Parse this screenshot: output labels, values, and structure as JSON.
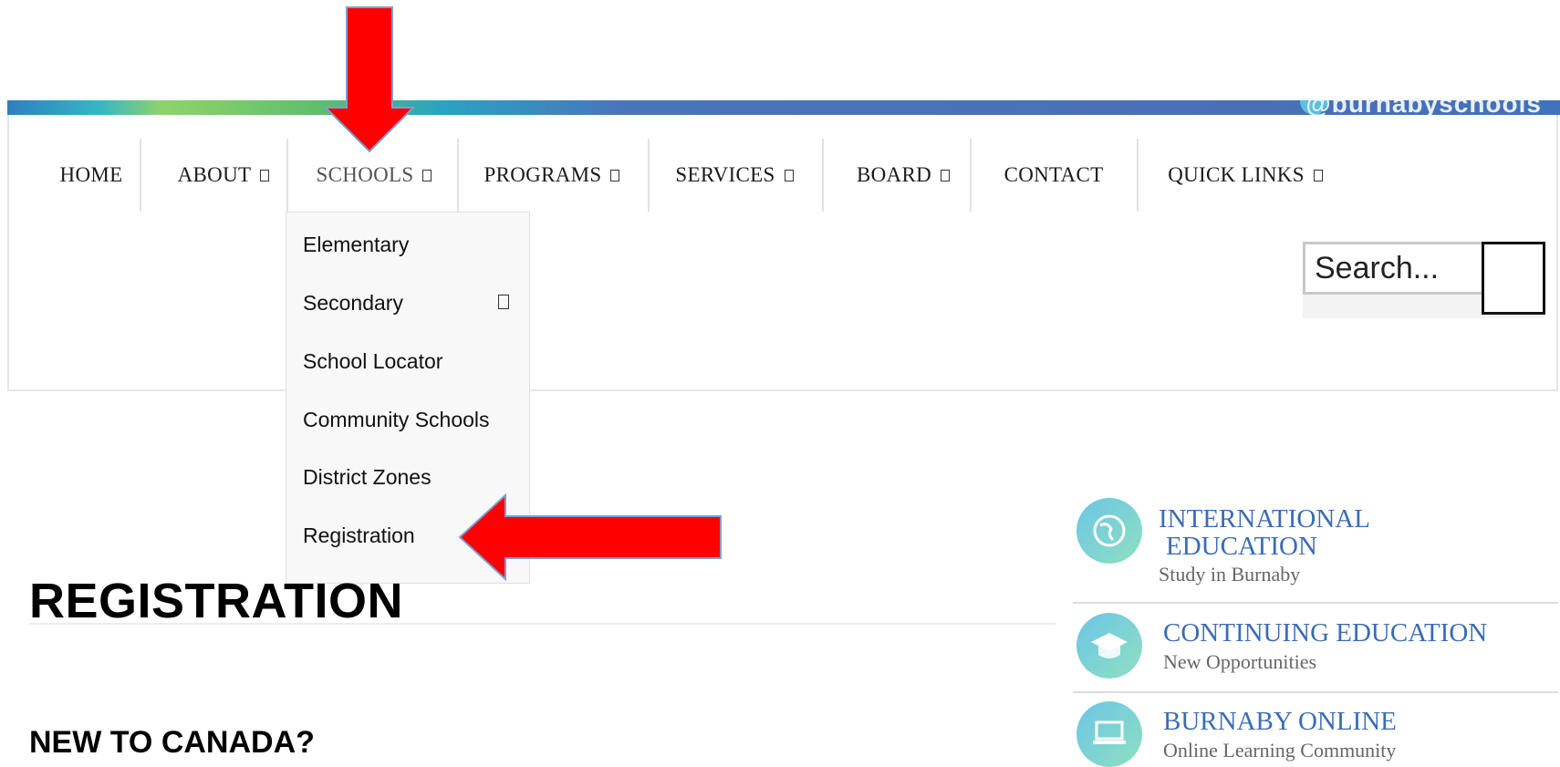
{
  "banner": {
    "handle": "@burnabyschools"
  },
  "nav": {
    "items": [
      {
        "label": "HOME",
        "caret": false
      },
      {
        "label": "ABOUT",
        "caret": true
      },
      {
        "label": "SCHOOLS",
        "caret": true
      },
      {
        "label": "PROGRAMS",
        "caret": true
      },
      {
        "label": "SERVICES",
        "caret": true
      },
      {
        "label": "BOARD",
        "caret": true
      },
      {
        "label": "CONTACT",
        "caret": false
      },
      {
        "label": "QUICK LINKS",
        "caret": true
      }
    ],
    "active": "SCHOOLS"
  },
  "search": {
    "placeholder": "Search..."
  },
  "dropdown": {
    "items": [
      "Elementary",
      "Secondary",
      "School Locator",
      "Community Schools",
      "District Zones",
      "Registration"
    ]
  },
  "main": {
    "title": "REGISTRATION",
    "subheading": "NEW TO CANADA?"
  },
  "sidebar": {
    "items": [
      {
        "title_line1": "INTERNATIONAL",
        "title_line2": "EDUCATION",
        "subtitle": "Study in Burnaby",
        "icon": "globe-icon"
      },
      {
        "title_line1": "CONTINUING EDUCATION",
        "subtitle": "New Opportunities",
        "icon": "graduation-cap-icon"
      },
      {
        "title_line1": "BURNABY ONLINE",
        "subtitle": "Online Learning Community",
        "icon": "laptop-icon"
      }
    ]
  },
  "colors": {
    "accent": "#3a6cb5",
    "arrow": "#ff0000"
  }
}
